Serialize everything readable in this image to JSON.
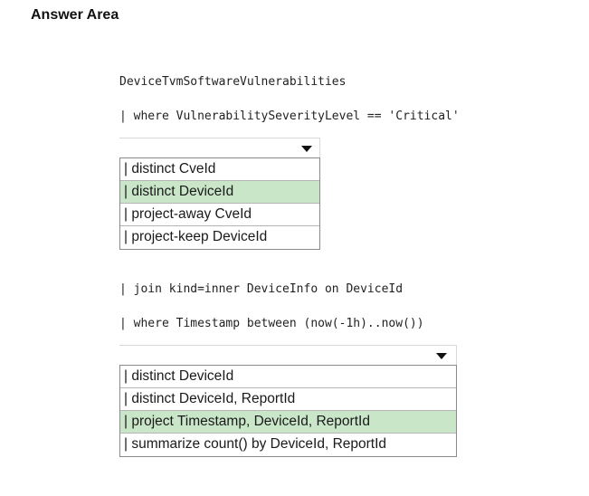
{
  "heading": "Answer Area",
  "query": {
    "line1": "DeviceTvmSoftwareVulnerabilities",
    "line2": "| where VulnerabilitySeverityLevel == 'Critical'",
    "line3": "| join kind=inner DeviceInfo on DeviceId",
    "line4": "| where Timestamp between (now(-1h)..now())"
  },
  "dropdown1": {
    "options": [
      {
        "label": "| distinct CveId",
        "selected": false
      },
      {
        "label": "| distinct DeviceId",
        "selected": true
      },
      {
        "label": "| project-away CveId",
        "selected": false
      },
      {
        "label": "| project-keep DeviceId",
        "selected": false
      }
    ],
    "selected_color": "#c9e6c9"
  },
  "dropdown2": {
    "options": [
      {
        "label": "| distinct DeviceId",
        "selected": false
      },
      {
        "label": "| distinct DeviceId, ReportId",
        "selected": false
      },
      {
        "label": "| project Timestamp, DeviceId, ReportId",
        "selected": true
      },
      {
        "label": "| summarize count() by DeviceId, ReportId",
        "selected": false
      }
    ],
    "selected_color": "#c9e6c9"
  },
  "icons": {
    "dropdown_arrow": "caret-down-icon"
  }
}
